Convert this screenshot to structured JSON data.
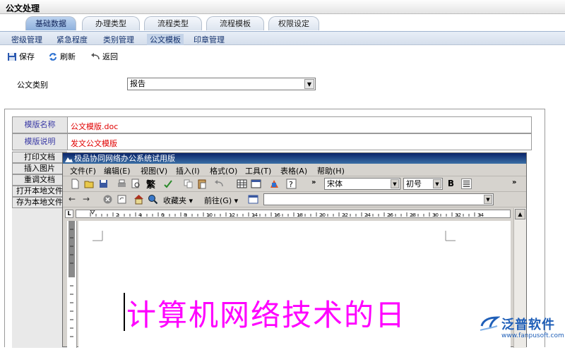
{
  "window": {
    "title": "公文处理"
  },
  "tabs": [
    {
      "label": "基础数据",
      "active": true
    },
    {
      "label": "办理类型",
      "active": false
    },
    {
      "label": "流程类型",
      "active": false
    },
    {
      "label": "流程模板",
      "active": false
    },
    {
      "label": "权限设定",
      "active": false
    }
  ],
  "subnav": [
    {
      "label": "密级管理"
    },
    {
      "label": "紧急程度"
    },
    {
      "label": "类别管理"
    },
    {
      "label": "公文模板",
      "selected": true
    },
    {
      "label": "印章管理"
    }
  ],
  "toolbar": {
    "save": "保存",
    "refresh": "刷新",
    "back": "返回"
  },
  "form": {
    "category_label": "公文类别",
    "category_value": "报告"
  },
  "template": {
    "name_label": "模版名称",
    "name_value": "公文模版.doc",
    "desc_label": "模版说明",
    "desc_value": "发文公文模版",
    "side_buttons": [
      "打印文档",
      "插入图片",
      "重调文档",
      "打开本地文件",
      "存为本地文件"
    ]
  },
  "doc": {
    "title": "极品协同网络办公系统试用版",
    "menu": [
      "文件(F)",
      "编辑(E)",
      "视图(V)",
      "插入(I)",
      "格式(O)",
      "工具(T)",
      "表格(A)",
      "帮助(H)"
    ],
    "toolbar1": {
      "fanti": "繁",
      "font": "宋体",
      "size": "初号",
      "bold": "B"
    },
    "toolbar2": {
      "favorites": "收藏夹",
      "goto": "前往(G)"
    },
    "ruler_labels": [
      "2",
      "4",
      "6",
      "8",
      "10",
      "12",
      "14",
      "16",
      "18",
      "20",
      "22",
      "24",
      "26",
      "28",
      "30",
      "32",
      "34"
    ],
    "body_text": "计算机网络技术的日"
  },
  "watermark": {
    "name": "泛普软件",
    "url": "www.fanpusoft.com"
  },
  "colors": {
    "accent": "#3a6ea5",
    "red": "#e00000",
    "magenta": "#ff00ff",
    "label_blue": "#3a3aa5"
  }
}
